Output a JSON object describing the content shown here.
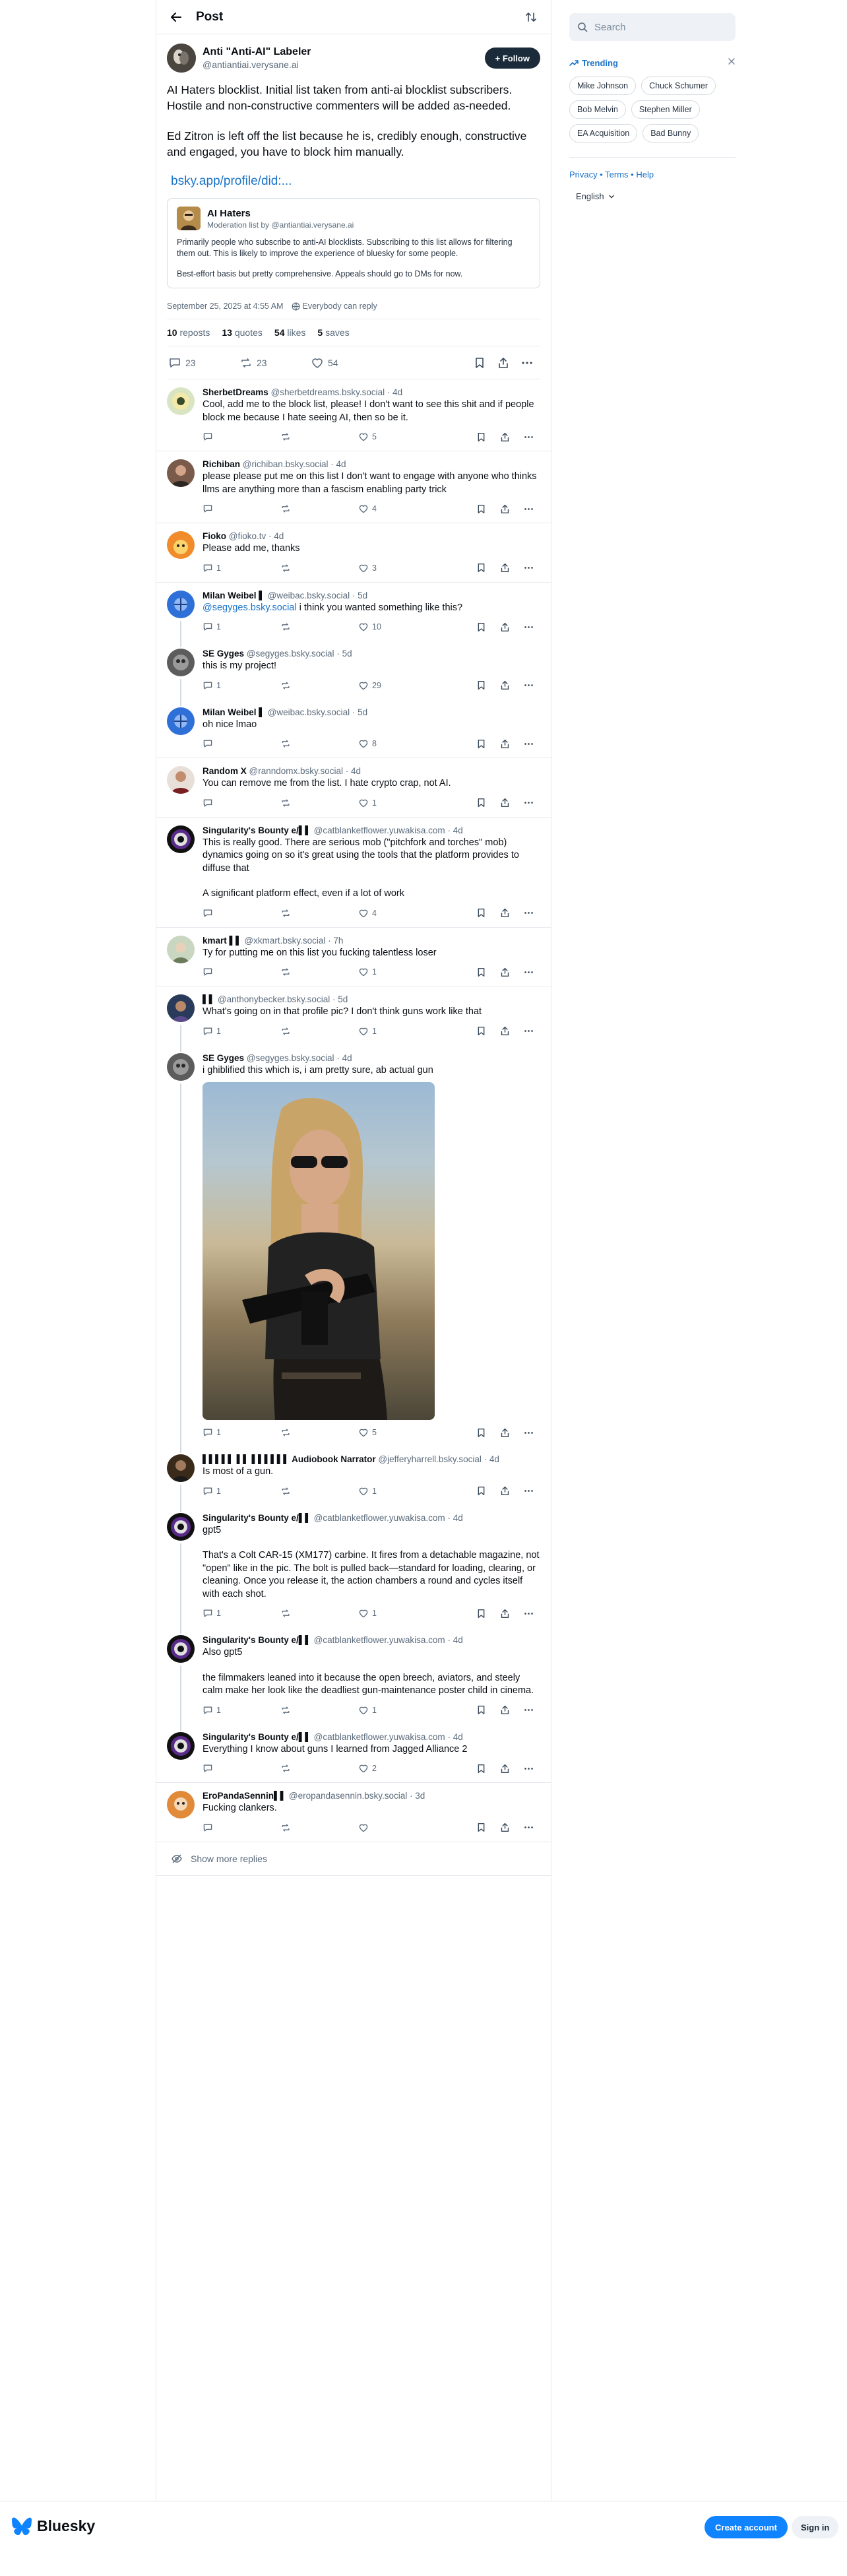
{
  "header": {
    "title": "Post"
  },
  "main_post": {
    "display_name": "Anti \"Anti-AI\" Labeler",
    "handle": "@antiantiai.verysane.ai",
    "follow_label": "+ Follow",
    "paragraphs": [
      "AI Haters blocklist. Initial list taken from anti-ai blocklist subscribers. Hostile and non-constructive commenters will be added as-needed.",
      "Ed Zitron is left off the list because he is, credibly enough, constructive and engaged, you have to block him manually."
    ],
    "link": "bsky.app/profile/did:...",
    "list_card": {
      "title": "AI Haters",
      "subtitle": "Moderation list by @antiantiai.verysane.ai",
      "desc1": "Primarily people who subscribe to anti-AI blocklists. Subscribing to this list allows for filtering them out. This is likely to improve the experience of bluesky for some people.",
      "desc2": "Best-effort basis but pretty comprehensive. Appeals should go to DMs for now."
    },
    "timestamp": "September 25, 2025 at 4:55 AM",
    "reply_setting": "Everybody can reply",
    "stats": {
      "reposts": "10",
      "reposts_label": "reposts",
      "quotes": "13",
      "quotes_label": "quotes",
      "likes": "54",
      "likes_label": "likes",
      "saves": "5",
      "saves_label": "saves"
    },
    "actions": {
      "replies": "23",
      "reposts": "23",
      "likes": "54"
    }
  },
  "replies": [
    {
      "name": "SherbetDreams",
      "handle": "@sherbetdreams.bsky.social",
      "time": "4d",
      "p1": "Cool, add me to the block list, please! I don't want to see this shit and if people block me because I hate seeing AI, then so be it.",
      "reply_count": "",
      "repost_count": "",
      "like_count": "5"
    },
    {
      "name": "Richiban",
      "handle": "@richiban.bsky.social",
      "time": "4d",
      "p1": "please please put me on this list I don't want to engage with anyone who thinks llms are anything more than a fascism enabling party trick",
      "reply_count": "",
      "repost_count": "",
      "like_count": "4"
    },
    {
      "name": "Fioko",
      "handle": "@fioko.tv",
      "time": "4d",
      "p1": "Please add me, thanks",
      "reply_count": "1",
      "repost_count": "",
      "like_count": "3"
    },
    {
      "name": "Milan Weibel ▌",
      "handle": "@weibac.bsky.social",
      "time": "5d",
      "mention": "@segyges.bsky.social",
      "p1": " i think you wanted something like this?",
      "reply_count": "1",
      "repost_count": "",
      "like_count": "10"
    },
    {
      "name": "SE Gyges",
      "handle": "@segyges.bsky.social",
      "time": "5d",
      "p1": "this is my project!",
      "reply_count": "1",
      "repost_count": "",
      "like_count": "29"
    },
    {
      "name": "Milan Weibel ▌",
      "handle": "@weibac.bsky.social",
      "time": "5d",
      "p1": "oh nice lmao",
      "reply_count": "",
      "repost_count": "",
      "like_count": "8"
    },
    {
      "name": "Random X",
      "handle": "@ranndomx.bsky.social",
      "time": "4d",
      "p1": "You can remove me from the list. I hate crypto crap, not AI.",
      "reply_count": "",
      "repost_count": "",
      "like_count": "1"
    },
    {
      "name": "Singularity's Bounty e/▌▌",
      "handle": "@catblanketflower.yuwakisa.com",
      "time": "4d",
      "p1": "This is really good. There are serious mob (\"pitchfork and torches\" mob) dynamics going on so it's great using the tools that the platform provides to diffuse that",
      "p2": "A significant platform effect, even if a lot of work",
      "reply_count": "",
      "repost_count": "",
      "like_count": "4"
    },
    {
      "name": "kmart ▌▌",
      "handle": "@xkmart.bsky.social",
      "time": "7h",
      "p1": "Ty for putting me on this list you fucking talentless loser",
      "reply_count": "",
      "repost_count": "",
      "like_count": "1"
    },
    {
      "name": "▌▌",
      "handle": "@anthonybecker.bsky.social",
      "time": "5d",
      "p1": "What's going on in that profile pic? I don't think guns work like that",
      "reply_count": "1",
      "repost_count": "",
      "like_count": "1"
    },
    {
      "name": "SE Gyges",
      "handle": "@segyges.bsky.social",
      "time": "4d",
      "p1": "i ghiblified this which is, i am pretty sure, ab actual gun",
      "reply_count": "1",
      "repost_count": "",
      "like_count": "5"
    },
    {
      "name": "▌▌▌▌▌ ▌▌ ▌▌▌▌▌▌ Audiobook Narrator",
      "handle": "@jefferyharrell.bsky.social",
      "time": "4d",
      "p1": "Is most of a gun.",
      "reply_count": "1",
      "repost_count": "",
      "like_count": "1"
    },
    {
      "name": "Singularity's Bounty e/▌▌",
      "handle": "@catblanketflower.yuwakisa.com",
      "time": "4d",
      "p1": "gpt5",
      "p2": "That's a Colt CAR-15 (XM177) carbine. It fires from a detachable magazine, not \"open\" like in the pic. The bolt is pulled back—standard for loading, clearing, or cleaning. Once you release it, the action chambers a round and cycles itself with each shot.",
      "reply_count": "1",
      "repost_count": "",
      "like_count": "1"
    },
    {
      "name": "Singularity's Bounty e/▌▌",
      "handle": "@catblanketflower.yuwakisa.com",
      "time": "4d",
      "p1": "Also gpt5",
      "p2": "the filmmakers leaned into it because the open breech, aviators, and steely calm make her look like the deadliest gun-maintenance poster child in cinema.",
      "reply_count": "1",
      "repost_count": "",
      "like_count": "1"
    },
    {
      "name": "Singularity's Bounty e/▌▌",
      "handle": "@catblanketflower.yuwakisa.com",
      "time": "4d",
      "p1": "Everything I know about guns I learned from Jagged Alliance 2",
      "reply_count": "",
      "repost_count": "",
      "like_count": "2"
    },
    {
      "name": "EroPandaSennin▌▌",
      "handle": "@eropandasennin.bsky.social",
      "time": "3d",
      "p1": "Fucking clankers.",
      "reply_count": "",
      "repost_count": "",
      "like_count": ""
    }
  ],
  "show_more": "Show more replies",
  "sidebar": {
    "search_placeholder": "Search",
    "trending_label": "Trending",
    "trends": [
      "Mike Johnson",
      "Chuck Schumer",
      "Bob Melvin",
      "Stephen Miller",
      "EA Acquisition",
      "Bad Bunny"
    ],
    "link_privacy": "Privacy",
    "link_terms": "Terms",
    "link_help": "Help",
    "sep": " • ",
    "language": "English"
  },
  "footer": {
    "brand": "Bluesky",
    "create_account": "Create account",
    "sign_in": "Sign in"
  },
  "colors": {
    "accent": "#1083fe",
    "link": "#1a73c9",
    "muted": "#5b6b7b",
    "border": "#e5e9ee"
  }
}
